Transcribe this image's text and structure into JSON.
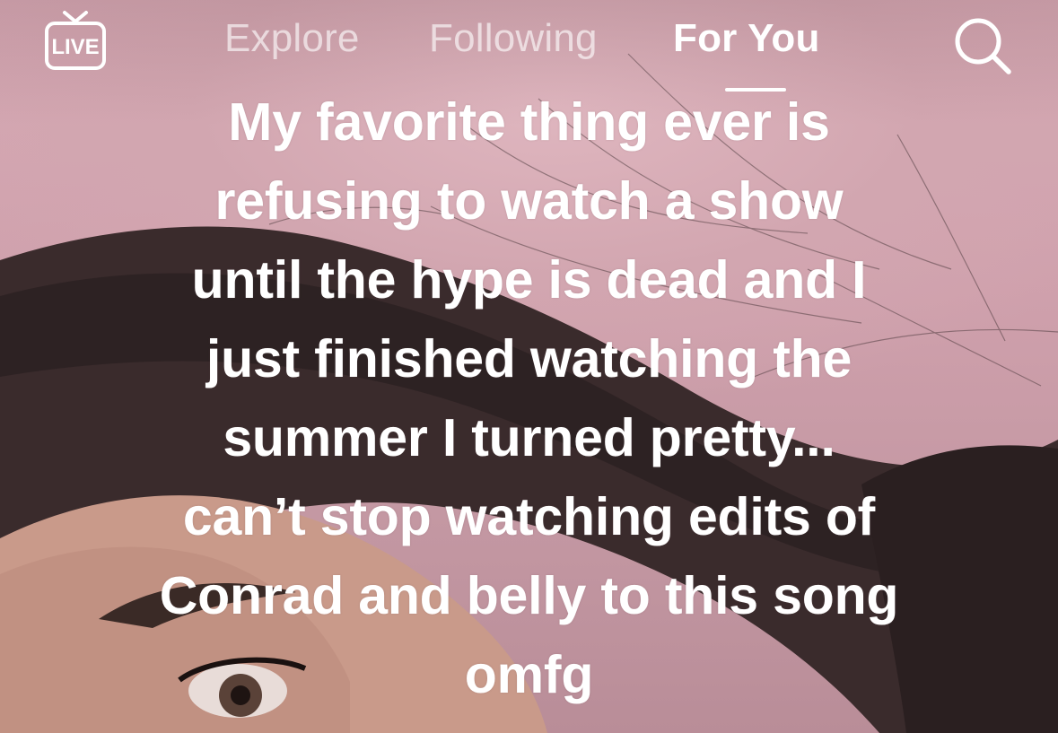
{
  "nav": {
    "live_label": "LIVE",
    "live_icon": "live-tv-icon",
    "tabs": [
      {
        "label": "Explore",
        "active": false
      },
      {
        "label": "Following",
        "active": false
      },
      {
        "label": "For You",
        "active": true
      }
    ],
    "search_icon": "search-icon"
  },
  "caption": {
    "lines": [
      "My favorite thing ever is",
      "refusing to watch a show",
      "until the hype is dead and I",
      "just finished watching the",
      "summer I turned pretty...",
      "can’t stop watching edits of",
      "Conrad and belly to this song",
      "omfg"
    ]
  },
  "colors": {
    "background": "#d2a6b0",
    "text": "#ffffff",
    "inactive_tab": "rgba(255,255,255,0.62)"
  }
}
